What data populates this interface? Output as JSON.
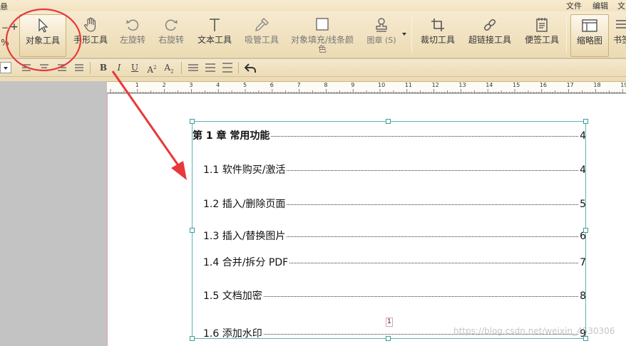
{
  "menubar": {
    "left_fragment": "悬",
    "items": [
      "文件",
      "编辑",
      "文"
    ]
  },
  "toolbar": {
    "zoom_fragment": "%",
    "object_tool": "对象工具",
    "hand_tool": "手形工具",
    "rotate_left": "左旋转",
    "rotate_right": "右旋转",
    "text_tool": "文本工具",
    "eyedropper_tool": "吸管工具",
    "fill_stroke_color": "对象填充/线条颜色",
    "stamp": "图章 (S)",
    "crop_tool": "裁切工具",
    "link_tool": "超链接工具",
    "note_tool": "便签工具",
    "thumbnail": "缩略图",
    "bookmark_fragment": "书签"
  },
  "formatbar": {
    "bold": "B",
    "italic": "I",
    "underline": "U"
  },
  "ruler": {
    "labels": [
      "1",
      "2",
      "3",
      "4",
      "5",
      "6",
      "7",
      "8",
      "9",
      "10",
      "11",
      "12",
      "13",
      "14",
      "15",
      "16",
      "17",
      "18",
      "19"
    ]
  },
  "toc": [
    {
      "title": "第 1 章  常用功能",
      "page": "4",
      "chapter": true
    },
    {
      "title": "1.1 软件购买/激活",
      "page": "4"
    },
    {
      "title": "1.2 插入/删除页面",
      "page": "5"
    },
    {
      "title": "1.3 插入/替换图片",
      "page": "6"
    },
    {
      "title": "1.4 合并/拆分 PDF",
      "page": "7"
    },
    {
      "title": "1.5 文档加密",
      "page": "8"
    },
    {
      "title": "1.6 添加水印",
      "page": "9"
    }
  ],
  "page_number": "1",
  "watermark": "https://blog.csdn.net/weixin_4530306",
  "colors": {
    "annotation_red": "#e8383b",
    "selection": "#5fb3b3",
    "toolbar_bg": "#f2e2c0"
  }
}
